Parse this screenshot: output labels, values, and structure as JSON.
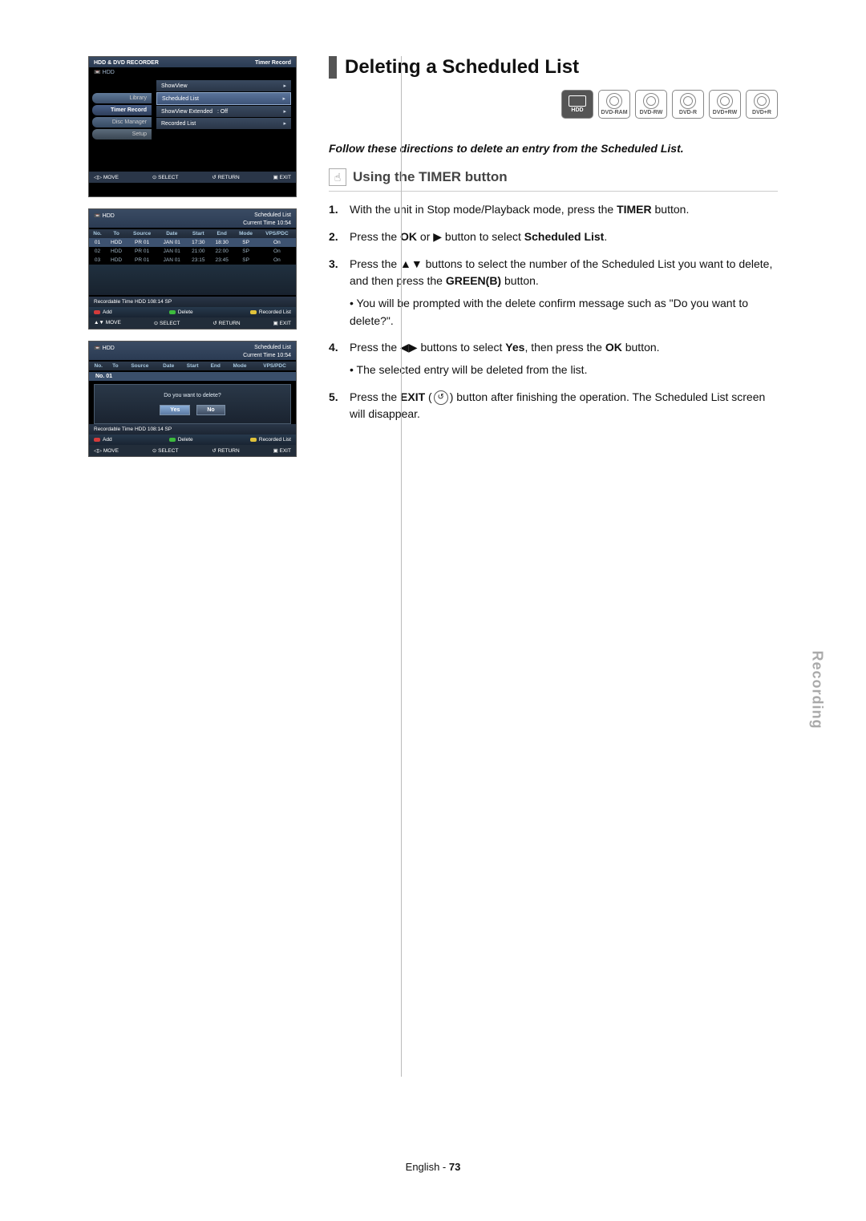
{
  "page_footer_lang": "English",
  "page_number": "73",
  "side_tab": "Recording",
  "section_title": "Deleting a Scheduled List",
  "intro": "Follow these directions to delete an entry from the Scheduled List.",
  "subheading": "Using the TIMER button",
  "discs": [
    "HDD",
    "DVD-RAM",
    "DVD-RW",
    "DVD-R",
    "DVD+RW",
    "DVD+R"
  ],
  "steps": [
    {
      "n": "1.",
      "parts": [
        "With the unit in Stop mode/Playback mode, press the ",
        {
          "b": "TIMER"
        },
        " button."
      ]
    },
    {
      "n": "2.",
      "parts": [
        "Press the ",
        {
          "b": "OK"
        },
        " or ▶ button to select ",
        {
          "b": "Scheduled List"
        },
        "."
      ]
    },
    {
      "n": "3.",
      "parts": [
        "Press the ▲▼ buttons to select the number of the Scheduled List you want to delete, and then press the ",
        {
          "b": "GREEN(B)"
        },
        " button."
      ],
      "bullets": [
        "You will be prompted with the delete confirm message such as \"Do you want to delete?\"."
      ]
    },
    {
      "n": "4.",
      "parts": [
        "Press the ◀▶ buttons to select ",
        {
          "b": "Yes"
        },
        ", then press the ",
        {
          "b": "OK"
        },
        " button."
      ],
      "bullets": [
        "The selected entry will be deleted from the list."
      ]
    },
    {
      "n": "5.",
      "parts": [
        "Press the ",
        {
          "b": "EXIT"
        },
        " (",
        {
          "icon": "↺"
        },
        ") button after finishing the operation. The Scheduled List screen will disappear."
      ]
    }
  ],
  "tv": {
    "brand": "HDD & DVD RECORDER",
    "corner": "Timer Record",
    "device": "HDD",
    "tabs": [
      "Library",
      "Timer Record",
      "Disc Manager",
      "Setup"
    ],
    "tab_selected_index": 1,
    "options": [
      {
        "label": "ShowView",
        "value": "",
        "arrow": "▸"
      },
      {
        "label": "Scheduled List",
        "value": "",
        "arrow": "▸",
        "sel": true
      },
      {
        "label": "ShowView Extended",
        "value": ": Off",
        "arrow": "▸"
      },
      {
        "label": "Recorded List",
        "value": "",
        "arrow": "▸"
      }
    ],
    "foot": {
      "move": "MOVE",
      "select": "SELECT",
      "return": "RETURN",
      "exit": "EXIT"
    }
  },
  "sched1": {
    "device": "HDD",
    "title": "Scheduled List",
    "time": "Current Time 10:54",
    "headers": [
      "No.",
      "To",
      "Source",
      "Date",
      "Start",
      "End",
      "Mode",
      "VPS/PDC"
    ],
    "rows": [
      [
        "01",
        "HDD",
        "PR 01",
        "JAN 01",
        "17:30",
        "18:30",
        "SP",
        "On"
      ],
      [
        "02",
        "HDD",
        "PR 01",
        "JAN 01",
        "21:00",
        "22:00",
        "SP",
        "On"
      ],
      [
        "03",
        "HDD",
        "PR 01",
        "JAN 01",
        "23:15",
        "23:45",
        "SP",
        "On"
      ]
    ],
    "hl_row": 0,
    "recordable": "Recordable Time   HDD  108:14 SP",
    "c": {
      "add": "Add",
      "delete": "Delete",
      "reclist": "Recorded List"
    },
    "foot": {
      "move": "MOVE",
      "select": "SELECT",
      "return": "RETURN",
      "exit": "EXIT"
    }
  },
  "sched2": {
    "device": "HDD",
    "title": "Scheduled List",
    "time": "Current Time 10:54",
    "headers": [
      "No.",
      "To",
      "Source",
      "Date",
      "Start",
      "End",
      "Mode",
      "VPS/PDC"
    ],
    "current": "No.  01",
    "confirm": "Do you want to delete?",
    "yes": "Yes",
    "no": "No",
    "recordable": "Recordable Time   HDD  108:14 SP",
    "c": {
      "add": "Add",
      "delete": "Delete",
      "reclist": "Recorded List"
    },
    "foot": {
      "move": "MOVE",
      "select": "SELECT",
      "return": "RETURN",
      "exit": "EXIT"
    }
  }
}
